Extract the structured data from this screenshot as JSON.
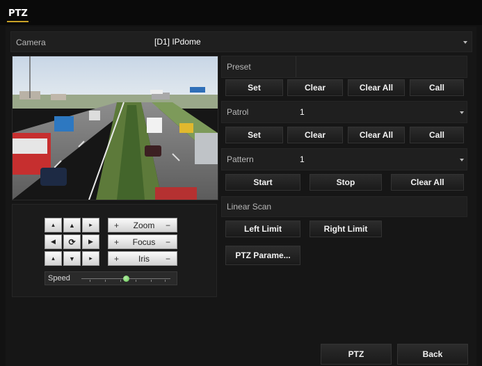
{
  "header": {
    "title": "PTZ"
  },
  "camera": {
    "label": "Camera",
    "value": "[D1] IPdome"
  },
  "preset": {
    "label": "Preset",
    "value": "",
    "buttons": [
      "Set",
      "Clear",
      "Clear All",
      "Call"
    ]
  },
  "patrol": {
    "label": "Patrol",
    "value": "1",
    "buttons": [
      "Set",
      "Clear",
      "Clear All",
      "Call"
    ]
  },
  "pattern": {
    "label": "Pattern",
    "value": "1",
    "buttons": [
      "Start",
      "Stop",
      "Clear All"
    ]
  },
  "linear_scan": {
    "label": "Linear Scan",
    "buttons": [
      "Left Limit",
      "Right Limit"
    ]
  },
  "ptz_parameters": {
    "label": "PTZ Parame..."
  },
  "controls": {
    "zoom": "Zoom",
    "focus": "Focus",
    "iris": "Iris",
    "speed_label": "Speed",
    "speed_level": 0.5
  },
  "footer": {
    "ptz_button": "PTZ",
    "back_button": "Back"
  },
  "colors": {
    "accent": "#c9a227",
    "speed_knob": "#5ec24f"
  }
}
